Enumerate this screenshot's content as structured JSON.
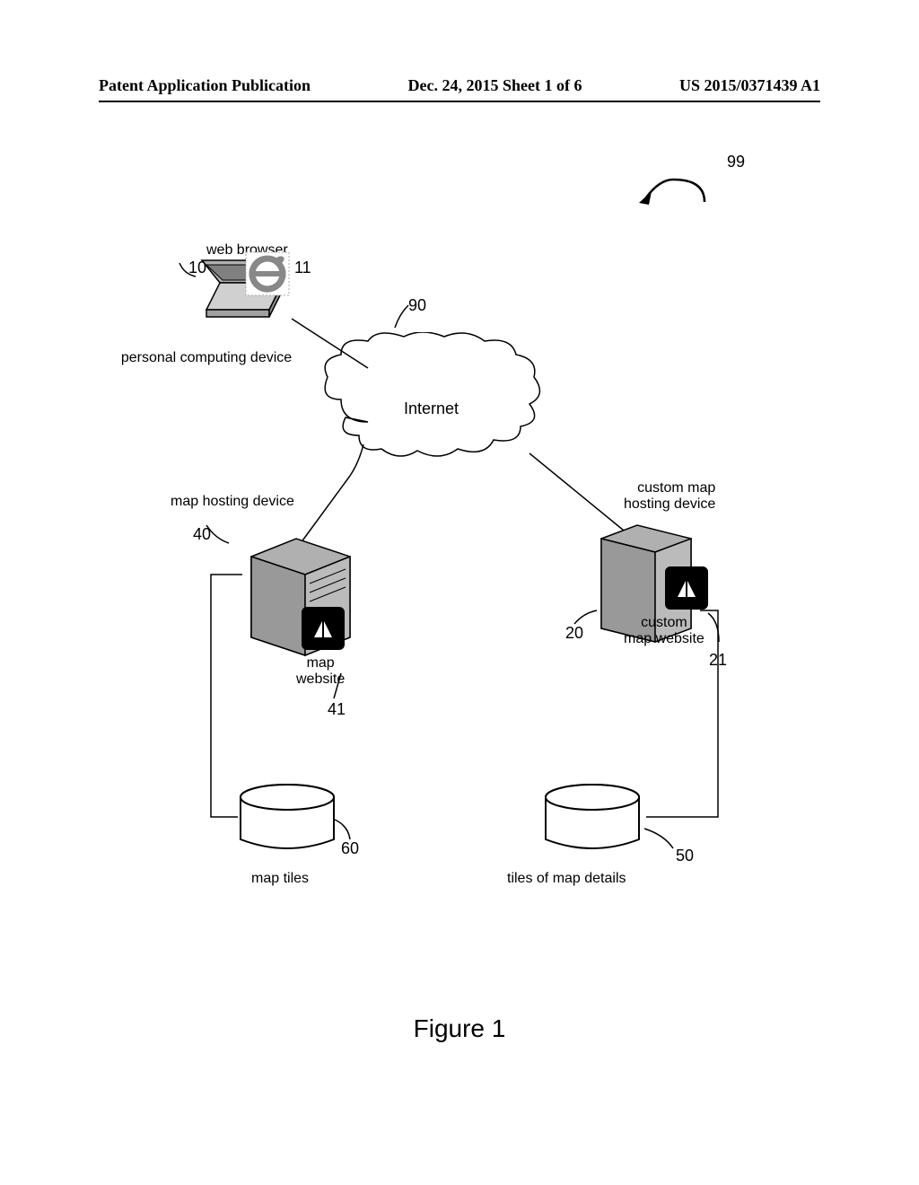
{
  "header": {
    "left": "Patent Application Publication",
    "center": "Dec. 24, 2015  Sheet 1 of 6",
    "right": "US 2015/0371439 A1"
  },
  "labels": {
    "web_browser": "web browser",
    "personal_computing_device": "personal computing device",
    "internet": "Internet",
    "map_hosting_device": "map hosting device",
    "custom_map_hosting_device": "custom map\nhosting device",
    "map_website": "map\nwebsite",
    "custom_map_website": "custom\nmap website",
    "map_tiles": "map tiles",
    "tiles_of_map_details": "tiles of map details"
  },
  "refs": {
    "r99": "99",
    "r10": "10",
    "r11": "11",
    "r90": "90",
    "r40": "40",
    "r41": "41",
    "r20": "20",
    "r21": "21",
    "r60": "60",
    "r50": "50"
  },
  "figure": "Figure 1"
}
